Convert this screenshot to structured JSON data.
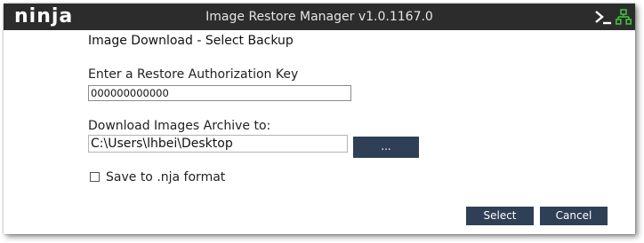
{
  "app": {
    "logo": "ninja",
    "window_title": "Image Restore Manager v1.0.1167.0",
    "icons": {
      "terminal": "terminal-icon",
      "network": "network-icon"
    },
    "colors": {
      "titlebar": "#2c2c2c",
      "button": "#2f3f55",
      "network_icon": "#3fbf3f"
    }
  },
  "dialog": {
    "heading": "Image Download - Select Backup",
    "key_label": "Enter a Restore Authorization Key",
    "key_value": "000000000000",
    "path_label": "Download Images Archive to:",
    "path_value": "C:\\Users\\lhbei\\Desktop",
    "browse_label": "...",
    "checkbox_label": "Save to .nja format",
    "checkbox_checked": false,
    "select_label": "Select",
    "cancel_label": "Cancel"
  }
}
